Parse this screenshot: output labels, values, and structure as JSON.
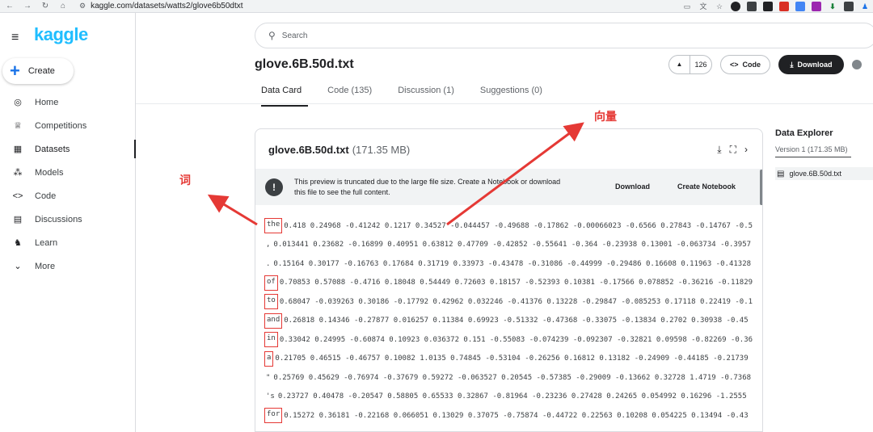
{
  "browser": {
    "url": "kaggle.com/datasets/watts2/glove6b50dtxt"
  },
  "sidebar": {
    "logo": "kaggle",
    "create_label": "Create",
    "items": [
      {
        "label": "Home",
        "icon": "compass-icon",
        "glyph": "◎"
      },
      {
        "label": "Competitions",
        "icon": "trophy-icon",
        "glyph": "♕"
      },
      {
        "label": "Datasets",
        "icon": "table-icon",
        "glyph": "▦",
        "active": true
      },
      {
        "label": "Models",
        "icon": "models-icon",
        "glyph": "⁂"
      },
      {
        "label": "Code",
        "icon": "code-icon",
        "glyph": "<>"
      },
      {
        "label": "Discussions",
        "icon": "discussions-icon",
        "glyph": "▤"
      },
      {
        "label": "Learn",
        "icon": "graduation-cap-icon",
        "glyph": "♞"
      },
      {
        "label": "More",
        "icon": "chevron-down-icon",
        "glyph": "⌄"
      }
    ]
  },
  "search": {
    "placeholder": "Search"
  },
  "header": {
    "title": "glove.6B.50d.txt",
    "upvotes": "126",
    "code_label": "Code",
    "download_label": "Download"
  },
  "tabs": [
    {
      "label": "Data Card",
      "active": true
    },
    {
      "label": "Code (135)"
    },
    {
      "label": "Discussion (1)"
    },
    {
      "label": "Suggestions (0)"
    }
  ],
  "file_card": {
    "filename": "glove.6B.50d.txt",
    "size": "(171.35 MB)",
    "banner_message": "This preview is truncated due to the large file size. Create a Notebook or download this file to see the full content.",
    "banner_download": "Download",
    "banner_notebook": "Create Notebook",
    "rows": [
      {
        "word": "the",
        "boxed": true,
        "vector": "0.418 0.24968 -0.41242 0.1217 0.34527 -0.044457 -0.49688 -0.17862 -0.00066023 -0.6566 0.27843 -0.14767 -0.5"
      },
      {
        "word": ",",
        "boxed": false,
        "vector": "0.013441 0.23682 -0.16899 0.40951 0.63812 0.47709 -0.42852 -0.55641 -0.364 -0.23938 0.13001 -0.063734 -0.3957"
      },
      {
        "word": ".",
        "boxed": false,
        "vector": "0.15164 0.30177 -0.16763 0.17684 0.31719 0.33973 -0.43478 -0.31086 -0.44999 -0.29486 0.16608 0.11963 -0.41328"
      },
      {
        "word": "of",
        "boxed": true,
        "vector": "0.70853 0.57088 -0.4716 0.18048 0.54449 0.72603 0.18157 -0.52393 0.10381 -0.17566 0.078852 -0.36216 -0.11829"
      },
      {
        "word": "to",
        "boxed": true,
        "vector": "0.68047 -0.039263 0.30186 -0.17792 0.42962 0.032246 -0.41376 0.13228 -0.29847 -0.085253 0.17118 0.22419 -0.1"
      },
      {
        "word": "and",
        "boxed": true,
        "vector": "0.26818 0.14346 -0.27877 0.016257 0.11384 0.69923 -0.51332 -0.47368 -0.33075 -0.13834 0.2702 0.30938 -0.45"
      },
      {
        "word": "in",
        "boxed": true,
        "vector": "0.33042 0.24995 -0.60874 0.10923 0.036372 0.151 -0.55083 -0.074239 -0.092307 -0.32821 0.09598 -0.82269 -0.36"
      },
      {
        "word": "a",
        "boxed": true,
        "vector": "0.21705 0.46515 -0.46757 0.10082 1.0135 0.74845 -0.53104 -0.26256 0.16812 0.13182 -0.24909 -0.44185 -0.21739"
      },
      {
        "word": "\"",
        "boxed": false,
        "vector": "0.25769 0.45629 -0.76974 -0.37679 0.59272 -0.063527 0.20545 -0.57385 -0.29009 -0.13662 0.32728 1.4719 -0.7368"
      },
      {
        "word": "'s",
        "boxed": false,
        "vector": "0.23727 0.40478 -0.20547 0.58805 0.65533 0.32867 -0.81964 -0.23236 0.27428 0.24265 0.054992 0.16296 -1.2555"
      },
      {
        "word": "for",
        "boxed": true,
        "vector": "0.15272 0.36181 -0.22168 0.066051 0.13029 0.37075 -0.75874 -0.44722 0.22563 0.10208 0.054225 0.13494 -0.43"
      }
    ]
  },
  "explorer": {
    "heading": "Data Explorer",
    "version": "Version 1 (171.35 MB)",
    "file": "glove.6B.50d.txt"
  },
  "annotations": {
    "word_label": "词",
    "vector_label": "向量",
    "color": "#e53935"
  },
  "colors": {
    "kaggle_blue": "#20beff",
    "primary_dark": "#202124"
  }
}
